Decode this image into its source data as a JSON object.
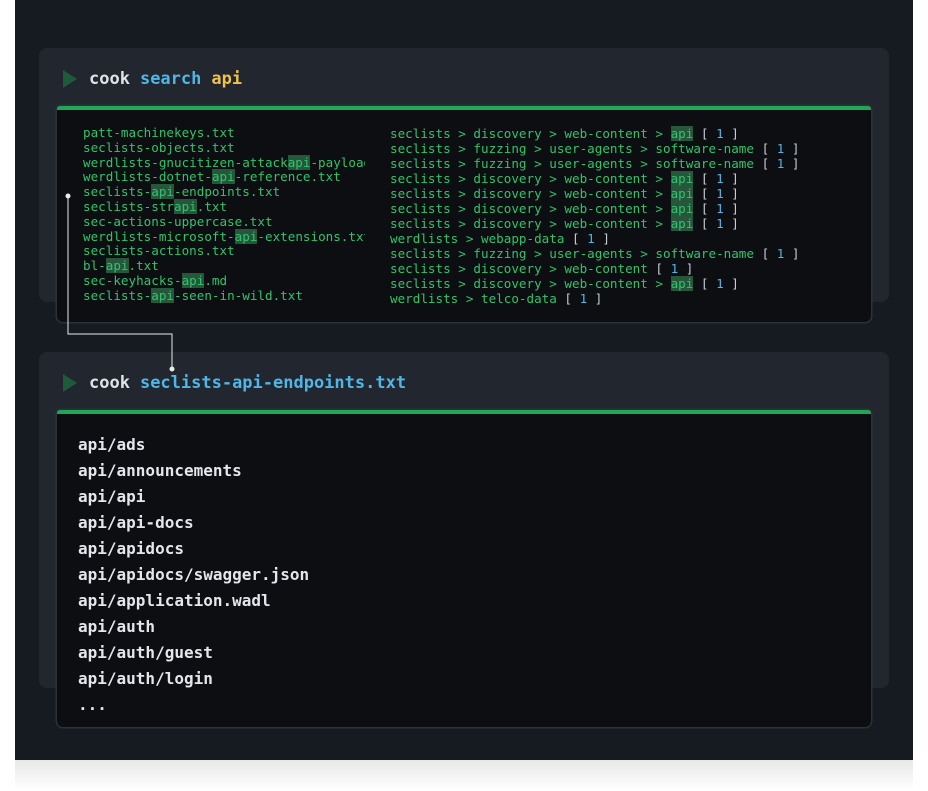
{
  "search_panel": {
    "command": "cook",
    "subcommand": "search",
    "argument": "api",
    "results": [
      {
        "parts": [
          "patt-machinekeys.txt"
        ],
        "path": [
          "seclists",
          "discovery",
          "web-content",
          "api"
        ],
        "count": "1"
      },
      {
        "parts": [
          "seclists-objects.txt"
        ],
        "path": [
          "seclists",
          "fuzzing",
          "user-agents",
          "software-name"
        ],
        "count": "1"
      },
      {
        "parts": [
          "werdlists-gnucitizen-attack",
          "api",
          "-payloads.txt"
        ],
        "path": [
          "seclists",
          "fuzzing",
          "user-agents",
          "software-name"
        ],
        "count": "1"
      },
      {
        "parts": [
          "werdlists-dotnet-",
          "api",
          "-reference.txt"
        ],
        "path": [
          "seclists",
          "discovery",
          "web-content",
          "api"
        ],
        "count": "1"
      },
      {
        "parts": [
          "seclists-",
          "api",
          "-endpoints.txt"
        ],
        "path": [
          "seclists",
          "discovery",
          "web-content",
          "api"
        ],
        "count": "1"
      },
      {
        "parts": [
          "seclists-str",
          "api",
          ".txt"
        ],
        "path": [
          "seclists",
          "discovery",
          "web-content",
          "api"
        ],
        "count": "1"
      },
      {
        "parts": [
          "sec-actions-uppercase.txt"
        ],
        "path": [
          "seclists",
          "discovery",
          "web-content",
          "api"
        ],
        "count": "1"
      },
      {
        "parts": [
          "werdlists-microsoft-",
          "api",
          "-extensions.txt"
        ],
        "path": [
          "werdlists",
          "webapp-data"
        ],
        "count": "1"
      },
      {
        "parts": [
          "seclists-actions.txt"
        ],
        "path": [
          "seclists",
          "fuzzing",
          "user-agents",
          "software-name"
        ],
        "count": "1"
      },
      {
        "parts": [
          "bl-",
          "api",
          ".txt"
        ],
        "path": [
          "seclists",
          "discovery",
          "web-content"
        ],
        "count": "1"
      },
      {
        "parts": [
          "sec-keyhacks-",
          "api",
          ".md"
        ],
        "path": [
          "seclists",
          "discovery",
          "web-content",
          "api"
        ],
        "count": "1"
      },
      {
        "parts": [
          "seclists-",
          "api",
          "-seen-in-wild.txt"
        ],
        "path": [
          "werdlists",
          "telco-data"
        ],
        "count": "1"
      }
    ]
  },
  "file_panel": {
    "command": "cook",
    "filename": "seclists-api-endpoints.txt",
    "lines": [
      "api/ads",
      "api/announcements",
      "api/api",
      "api/api-docs",
      "api/apidocs",
      "api/apidocs/swagger.json",
      "api/application.wadl",
      "api/auth",
      "api/auth/guest",
      "api/auth/login",
      "..."
    ]
  },
  "colors": {
    "background": "#161b22",
    "card": "#21262f",
    "terminal": "#0d0e11",
    "accent_green": "#2fc46d",
    "keyword_blue": "#4fb6e6",
    "argument_yellow": "#f0c24b",
    "highlight": "#27573b"
  },
  "icons": [
    "play-icon"
  ]
}
